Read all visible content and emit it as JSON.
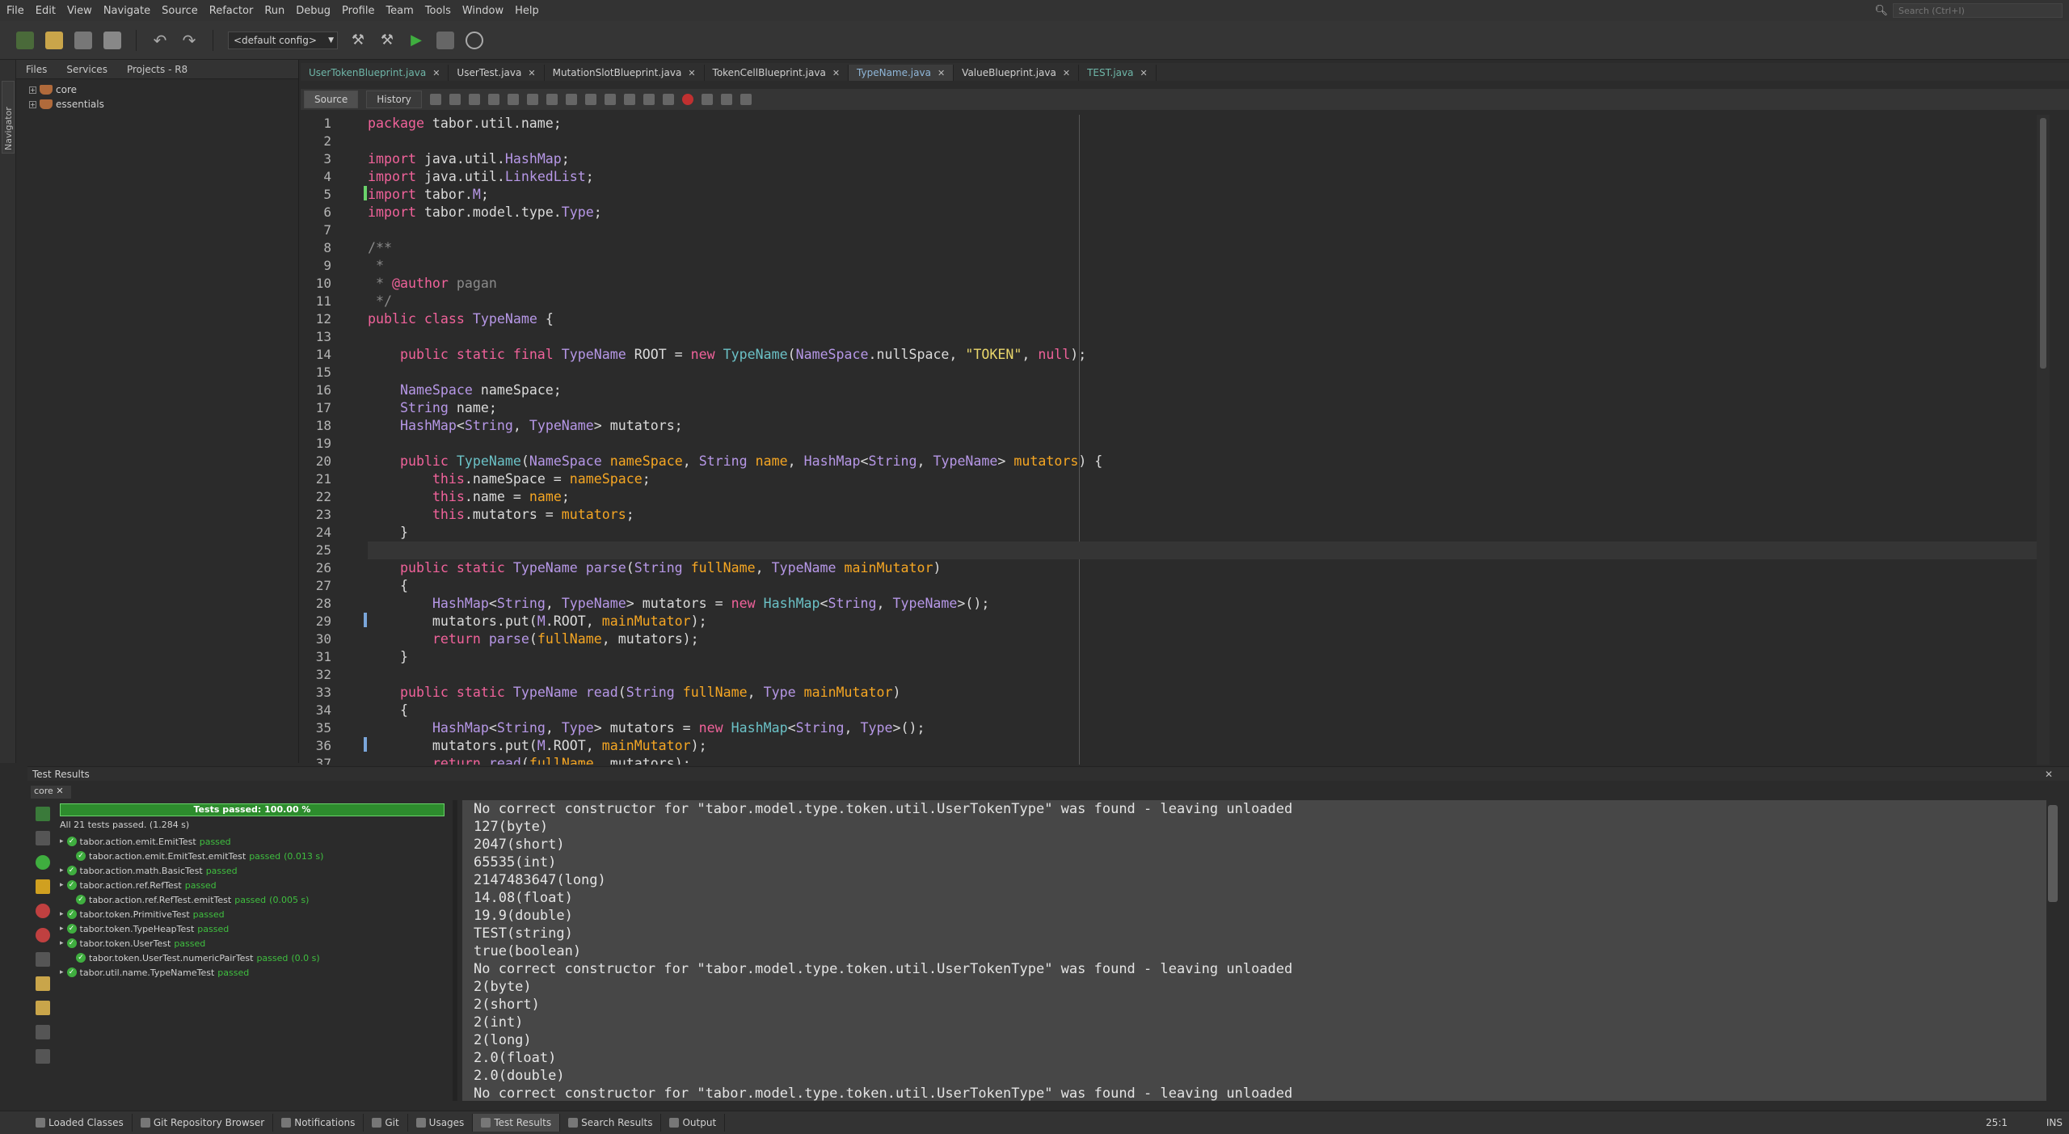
{
  "menu": [
    "File",
    "Edit",
    "View",
    "Navigate",
    "Source",
    "Refactor",
    "Run",
    "Debug",
    "Profile",
    "Team",
    "Tools",
    "Window",
    "Help"
  ],
  "search": {
    "placeholder": "Search (Ctrl+I)"
  },
  "toolbar": {
    "config": "<default config>"
  },
  "projects": {
    "tabs": [
      "Files",
      "Services",
      "Projects - R8"
    ],
    "tree": [
      "core",
      "essentials"
    ]
  },
  "navigator_label": "Navigator",
  "editor_tabs": [
    {
      "label": "UserTokenBlueprint.java",
      "state": "green"
    },
    {
      "label": "UserTest.java",
      "state": ""
    },
    {
      "label": "MutationSlotBlueprint.java",
      "state": ""
    },
    {
      "label": "TokenCellBlueprint.java",
      "state": ""
    },
    {
      "label": "TypeName.java",
      "state": "active"
    },
    {
      "label": "ValueBlueprint.java",
      "state": ""
    },
    {
      "label": "TEST.java",
      "state": "green"
    }
  ],
  "editor_subtabs": [
    "Source",
    "History"
  ],
  "code": {
    "line_numbers": [
      "1",
      "2",
      "3",
      "4",
      "5",
      "6",
      "7",
      "8",
      "9",
      "10",
      "11",
      "12",
      "13",
      "14",
      "15",
      "16",
      "17",
      "18",
      "19",
      "20",
      "21",
      "22",
      "23",
      "24",
      "25",
      "26",
      "27",
      "28",
      "29",
      "30",
      "31",
      "32",
      "33",
      "34",
      "35",
      "36",
      "37"
    ],
    "current_line": 25
  },
  "test_results": {
    "title": "Test Results",
    "project_tab": "core",
    "progress_label": "Tests passed: 100.00 %",
    "progress_fraction": 1.0,
    "summary": "All 21 tests passed. (1.284 s)",
    "rows": [
      {
        "indent": 0,
        "name": "tabor.action.emit.EmitTest",
        "status": "passed",
        "time": ""
      },
      {
        "indent": 1,
        "name": "tabor.action.emit.EmitTest.emitTest",
        "status": "passed",
        "time": "(0.013 s)"
      },
      {
        "indent": 0,
        "name": "tabor.action.math.BasicTest",
        "status": "passed",
        "time": ""
      },
      {
        "indent": 0,
        "name": "tabor.action.ref.RefTest",
        "status": "passed",
        "time": ""
      },
      {
        "indent": 1,
        "name": "tabor.action.ref.RefTest.emitTest",
        "status": "passed",
        "time": "(0.005 s)"
      },
      {
        "indent": 0,
        "name": "tabor.token.PrimitiveTest",
        "status": "passed",
        "time": ""
      },
      {
        "indent": 0,
        "name": "tabor.token.TypeHeapTest",
        "status": "passed",
        "time": ""
      },
      {
        "indent": 0,
        "name": "tabor.token.UserTest",
        "status": "passed",
        "time": ""
      },
      {
        "indent": 1,
        "name": "tabor.token.UserTest.numericPairTest",
        "status": "passed",
        "time": "(0.0 s)"
      },
      {
        "indent": 0,
        "name": "tabor.util.name.TypeNameTest",
        "status": "passed",
        "time": ""
      }
    ],
    "output": [
      "No correct constructor for \"tabor.model.type.token.util.UserTokenType\" was found - leaving unloaded",
      "127(byte)",
      "2047(short)",
      "65535(int)",
      "2147483647(long)",
      "14.08(float)",
      "19.9(double)",
      "TEST(string)",
      "true(boolean)",
      "No correct constructor for \"tabor.model.type.token.util.UserTokenType\" was found - leaving unloaded",
      "2(byte)",
      "2(short)",
      "2(int)",
      "2(long)",
      "2.0(float)",
      "2.0(double)",
      "No correct constructor for \"tabor.model.type.token.util.UserTokenType\" was found - leaving unloaded"
    ]
  },
  "statusbar": {
    "items": [
      {
        "label": "Loaded Classes",
        "icon": "classes-icon"
      },
      {
        "label": "Git Repository Browser",
        "icon": "git-browser-icon"
      },
      {
        "label": "Notifications",
        "icon": "notifications-icon"
      },
      {
        "label": "Git",
        "icon": "git-icon"
      },
      {
        "label": "Usages",
        "icon": "usages-icon"
      },
      {
        "label": "Test Results",
        "icon": "test-results-icon",
        "active": true
      },
      {
        "label": "Search Results",
        "icon": "search-results-icon"
      },
      {
        "label": "Output",
        "icon": "output-icon"
      }
    ],
    "caret": "25:1",
    "mode": "INS"
  },
  "colors": {
    "accent_green": "#3fae3f",
    "keyword": "#f0629a",
    "type": "#b697e6",
    "class": "#6bc1c6",
    "string": "#e9d66b",
    "param": "#f5a623"
  }
}
